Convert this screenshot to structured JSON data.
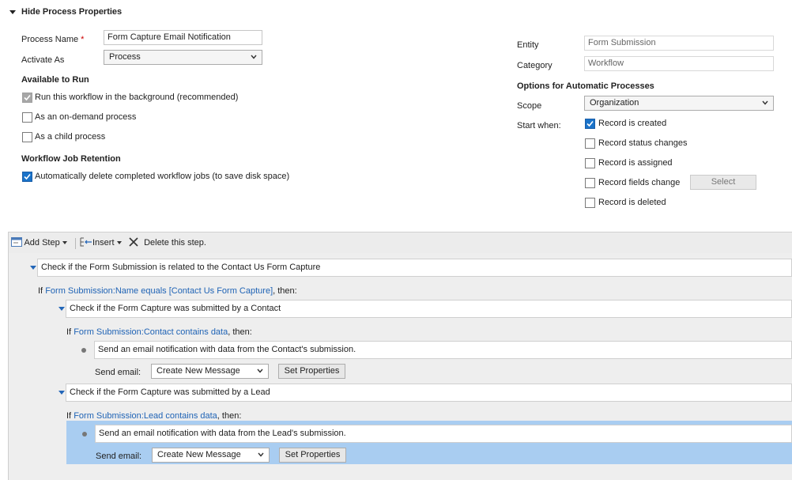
{
  "header": {
    "toggle_label": "Hide Process Properties"
  },
  "left": {
    "process_name_label": "Process Name",
    "required_mark": "*",
    "process_name_value": "Form Capture Email Notification",
    "activate_as_label": "Activate As",
    "activate_as_value": "Process",
    "available_to_run_heading": "Available to Run",
    "run_background_label": "Run this workflow in the background (recommended)",
    "on_demand_label": "As an on-demand process",
    "child_process_label": "As a child process",
    "retention_heading": "Workflow Job Retention",
    "auto_delete_label": "Automatically delete completed workflow jobs (to save disk space)"
  },
  "right": {
    "entity_label": "Entity",
    "entity_value": "Form Submission",
    "category_label": "Category",
    "category_value": "Workflow",
    "options_heading": "Options for Automatic Processes",
    "scope_label": "Scope",
    "scope_value": "Organization",
    "start_when_label": "Start when:",
    "record_created": "Record is created",
    "record_status": "Record status changes",
    "record_assigned": "Record is assigned",
    "record_fields": "Record fields change",
    "select_button": "Select",
    "record_deleted": "Record is deleted"
  },
  "toolbar": {
    "add_step": "Add Step",
    "insert": "Insert",
    "delete": "Delete this step."
  },
  "steps": {
    "step1_title": "Check if the Form Submission is related to the Contact Us Form Capture",
    "cond1_prefix": "If",
    "cond1_link": "Form Submission:Name equals [Contact Us Form Capture]",
    "cond1_suffix": ", then:",
    "step2_title": "Check if the Form Capture was submitted by a Contact",
    "cond2_prefix": "If",
    "cond2_link": "Form Submission:Contact contains data",
    "cond2_suffix": ", then:",
    "email1_desc": "Send an email notification with data from the Contact's submission.",
    "email1_send_label": "Send email:",
    "email1_select": "Create New Message",
    "email1_button": "Set Properties",
    "step3_title": "Check if the Form Capture was submitted by a Lead",
    "cond3_prefix": "If",
    "cond3_link": "Form Submission:Lead contains data",
    "cond3_suffix": ", then:",
    "email2_desc": "Send an email notification with data from the Lead's submission.",
    "email2_send_label": "Send email:",
    "email2_select": "Create New Message",
    "email2_button": "Set Properties"
  },
  "colors": {
    "accent": "#1a73c9",
    "link": "#1f63b5",
    "highlight": "#a9cdf1"
  }
}
